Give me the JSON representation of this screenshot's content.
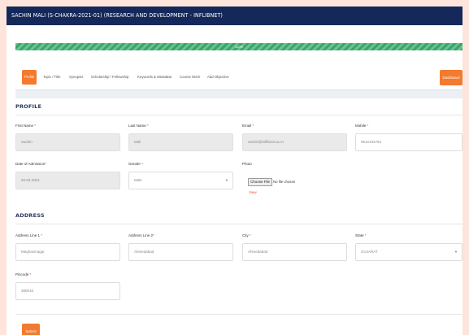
{
  "header": {
    "title": "SACHIN MALI (S-CHAKRA-2021-01) (RESEARCH AND DEVELOPMENT - INFLIBNET)"
  },
  "progress": {
    "label": "100%",
    "value": 100
  },
  "tabs": [
    {
      "label": "Profile",
      "active": true
    },
    {
      "label": "Topic / Title"
    },
    {
      "label": "Synopsis"
    },
    {
      "label": "Scholarship / Fellowship"
    },
    {
      "label": "Keywords & Metadata"
    },
    {
      "label": "Course Work"
    },
    {
      "label": "Add Objective"
    }
  ],
  "dashboard_label": "Dashboard",
  "profile": {
    "section_title": "PROFILE",
    "first_name": {
      "label": "First Name",
      "value": "Sachin"
    },
    "last_name": {
      "label": "Last Name",
      "value": "Mali"
    },
    "email": {
      "label": "Email",
      "value": "sachin@inflibnet.ac.in"
    },
    "mobile": {
      "label": "Mobile",
      "value": "9510192784"
    },
    "date_of_admission": {
      "label": "Date of Admission",
      "value": "20-04-2021"
    },
    "gender": {
      "label": "Gender",
      "value": "Male"
    },
    "photo": {
      "label": "Photo",
      "button": "Choose File",
      "status": "No file chosen",
      "view_link": "View"
    }
  },
  "address": {
    "section_title": "ADDRESS",
    "line1": {
      "label": "Address Line 1",
      "value": "Meghaninagar"
    },
    "line2": {
      "label": "Address Line 2",
      "value": "Ahmedabad"
    },
    "city": {
      "label": "City",
      "value": "Ahmedabad"
    },
    "state": {
      "label": "State",
      "value": "GUJARAT"
    },
    "pincode": {
      "label": "Pincode",
      "value": "380016"
    }
  },
  "submit_label": "Submit",
  "colors": {
    "header_bg": "#14295a",
    "accent": "#f37a2e",
    "progress": "#36a768",
    "required": "#e53935"
  }
}
